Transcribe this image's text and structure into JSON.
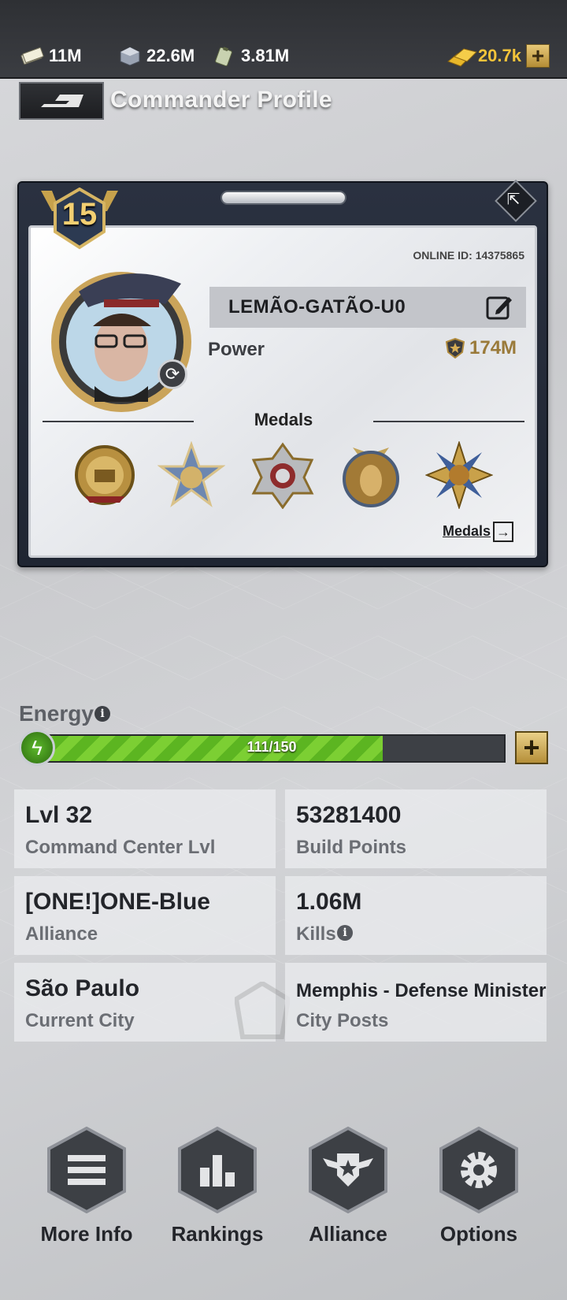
{
  "resources": [
    {
      "name": "cash-icon",
      "value": "11M"
    },
    {
      "name": "iron-icon",
      "value": "22.6M"
    },
    {
      "name": "oil-icon",
      "value": "3.81M"
    }
  ],
  "gold": {
    "value": "20.7k",
    "plus": "+"
  },
  "header": {
    "title": "Commander Profile"
  },
  "profile": {
    "level": "15",
    "online_id": "ONLINE ID: 14375865",
    "name": "LEMÃO-GATÃO-U0",
    "power_label": "Power",
    "power_value": "174M",
    "medals_title": "Medals",
    "medals_link": "Medals"
  },
  "energy": {
    "label": "Energy",
    "current": 111,
    "max": 150,
    "text": "111/150",
    "plus": "+"
  },
  "stats": [
    {
      "value": "Lvl 32",
      "label": "Command Center Lvl"
    },
    {
      "value": "53281400",
      "label": "Build Points"
    },
    {
      "value": "[ONE!]ONE-Blue",
      "label": "Alliance"
    },
    {
      "value": "1.06M",
      "label": "Kills"
    },
    {
      "value": "São Paulo",
      "label": "Current City"
    },
    {
      "value": "Memphis - Defense Minister",
      "label": "City Posts"
    }
  ],
  "nav": [
    {
      "label": "More Info",
      "icon": "menu-icon"
    },
    {
      "label": "Rankings",
      "icon": "bar-chart-icon"
    },
    {
      "label": "Alliance",
      "icon": "alliance-shield-icon"
    },
    {
      "label": "Options",
      "icon": "gear-icon"
    }
  ],
  "colors": {
    "accent_gold": "#f3c33a",
    "energy_green": "#7ccf33",
    "power_gold": "#9a7a3a"
  }
}
